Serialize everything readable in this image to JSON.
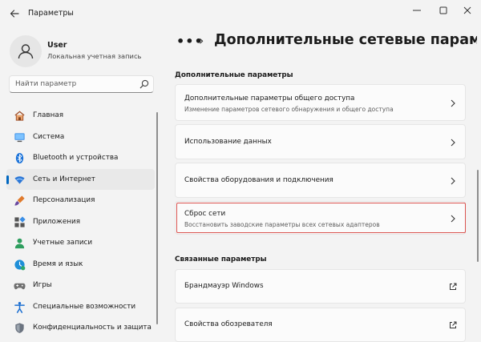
{
  "window": {
    "title": "Параметры",
    "controls": [
      "minimize-icon",
      "maximize-icon",
      "close-icon"
    ]
  },
  "user": {
    "name": "User",
    "account_type": "Локальная учетная запись"
  },
  "search": {
    "placeholder": "Найти параметр"
  },
  "sidebar": {
    "items": [
      {
        "label": "Главная",
        "icon": "home-icon",
        "active": false
      },
      {
        "label": "Система",
        "icon": "system-icon",
        "active": false
      },
      {
        "label": "Bluetooth и устройства",
        "icon": "bluetooth-icon",
        "active": false
      },
      {
        "label": "Сеть и Интернет",
        "icon": "network-icon",
        "active": true
      },
      {
        "label": "Персонализация",
        "icon": "personalization-icon",
        "active": false
      },
      {
        "label": "Приложения",
        "icon": "apps-icon",
        "active": false
      },
      {
        "label": "Учетные записи",
        "icon": "accounts-icon",
        "active": false
      },
      {
        "label": "Время и язык",
        "icon": "time-language-icon",
        "active": false
      },
      {
        "label": "Игры",
        "icon": "gaming-icon",
        "active": false
      },
      {
        "label": "Специальные возможности",
        "icon": "accessibility-icon",
        "active": false
      },
      {
        "label": "Конфиденциальность и защита",
        "icon": "privacy-shield-icon",
        "active": false
      }
    ]
  },
  "breadcrumb": {
    "overflow": "•••",
    "separator": "›",
    "title": "Дополнительные сетевые параметры"
  },
  "sections": {
    "advanced": {
      "title": "Дополнительные параметры",
      "cards": [
        {
          "title": "Дополнительные параметры общего доступа",
          "subtitle": "Изменение параметров сетевого обнаружения и общего доступа"
        },
        {
          "title": "Использование данных",
          "subtitle": ""
        },
        {
          "title": "Свойства оборудования и подключения",
          "subtitle": ""
        },
        {
          "title": "Сброс сети",
          "subtitle": "Восстановить заводские параметры всех сетевых адаптеров",
          "highlighted": true
        }
      ]
    },
    "related": {
      "title": "Связанные параметры",
      "cards": [
        {
          "title": "Брандмауэр Windows",
          "subtitle": ""
        },
        {
          "title": "Свойства обозревателя",
          "subtitle": ""
        }
      ]
    }
  },
  "colors": {
    "accent": "#0067c0",
    "highlight": "#d9534f",
    "background": "#f3f3f3",
    "card": "#fbfbfb"
  }
}
